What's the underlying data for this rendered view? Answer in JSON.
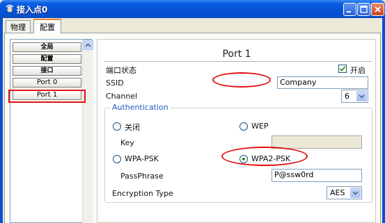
{
  "window": {
    "title": "接入点0",
    "controls": [
      "minimize-icon",
      "maximize-icon",
      "close-icon"
    ],
    "title_bar_color": "#0653d6"
  },
  "tabs": [
    {
      "label": "物理",
      "active": false
    },
    {
      "label": "配置",
      "active": true
    }
  ],
  "sidebar": {
    "items": [
      {
        "label": "全局",
        "bold": true
      },
      {
        "label": "配置",
        "bold": true
      },
      {
        "label": "接口",
        "bold": true
      },
      {
        "label": "Port 0",
        "bold": false
      },
      {
        "label": "Port 1",
        "bold": false,
        "highlighted": true
      }
    ]
  },
  "port": {
    "title": "Port 1",
    "status_label": "端口状态",
    "status_toggle_label": "开启",
    "status_on": true,
    "ssid_label": "SSID",
    "ssid_value": "Company",
    "channel_label": "Channel",
    "channel_value": "6"
  },
  "auth": {
    "legend": "Authentication",
    "options": [
      {
        "label": "关闭",
        "selected": false
      },
      {
        "label": "WEP",
        "selected": false
      },
      {
        "label": "WPA-PSK",
        "selected": false
      },
      {
        "label": "WPA2-PSK",
        "selected": true
      }
    ],
    "key_label": "Key",
    "key_value": "",
    "passphrase_label": "PassPhrase",
    "passphrase_value": "P@ssw0rd",
    "encryption_label": "Encryption Type",
    "encryption_value": "AES"
  },
  "colors": {
    "annotation": "#e01010",
    "active_tab_accent": "#e68b2c",
    "legend_text": "#1e5cc0",
    "radio_selected": "#2f8a1f"
  }
}
